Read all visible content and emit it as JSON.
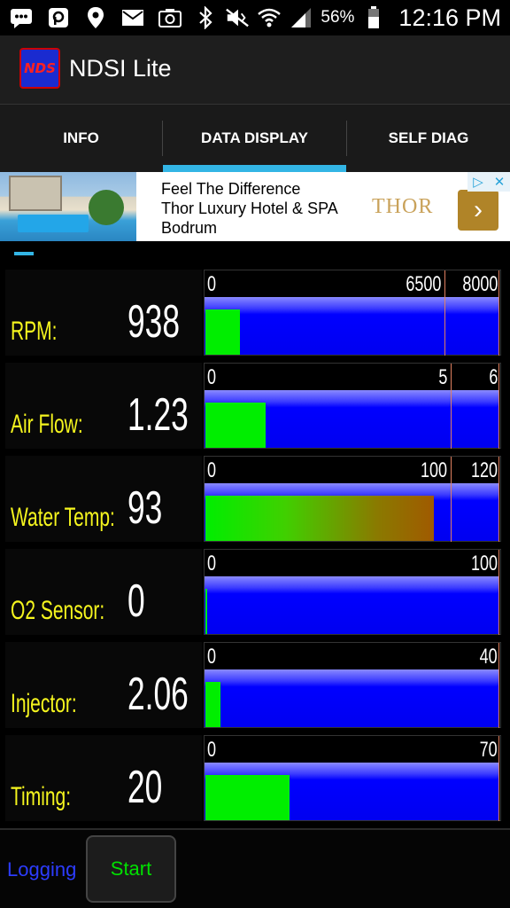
{
  "status_bar": {
    "battery_percent": "56%",
    "time": "12:16 PM",
    "icons": [
      "message-icon",
      "p-notification-icon",
      "location-icon",
      "email-icon",
      "camera-icon",
      "bluetooth-icon",
      "mute-icon",
      "wifi-icon",
      "signal-icon",
      "battery-icon"
    ]
  },
  "app": {
    "title": "NDSI Lite",
    "logo_text": "NDS"
  },
  "tabs": [
    {
      "label": "INFO"
    },
    {
      "label": "DATA DISPLAY",
      "selected": true
    },
    {
      "label": "SELF DIAG"
    }
  ],
  "ad": {
    "line1": "Feel The Difference",
    "line2": "Thor Luxury Hotel & SPA",
    "line3": "Bodrum",
    "brand": "THOR",
    "adchoices": "▷",
    "close": "✕",
    "go": "›"
  },
  "gauges": [
    {
      "label": "RPM:",
      "value": "938",
      "min": "0",
      "max_label": "8000",
      "mark_label": "6500",
      "max": 8000,
      "mark": 6500,
      "current": 938,
      "fill_style": "plain"
    },
    {
      "label": "Air Flow:",
      "value": "1.23",
      "min": "0",
      "max_label": "6",
      "mark_label": "5",
      "max": 6,
      "mark": 5,
      "current": 1.23,
      "fill_style": "plain"
    },
    {
      "label": "Water Temp:",
      "value": "93",
      "min": "0",
      "max_label": "120",
      "mark_label": "100",
      "max": 120,
      "mark": 100,
      "current": 93,
      "fill_style": "hot"
    },
    {
      "label": "O2 Sensor:",
      "value": "0",
      "min": "0",
      "max_label": "100",
      "mark_label": "",
      "max": 100,
      "mark": null,
      "current": 0,
      "fill_style": "plain"
    },
    {
      "label": "Injector:",
      "value": "2.06",
      "min": "0",
      "max_label": "40",
      "mark_label": "",
      "max": 40,
      "mark": null,
      "current": 2.06,
      "fill_style": "plain"
    },
    {
      "label": "Timing:",
      "value": "20",
      "min": "0",
      "max_label": "70",
      "mark_label": "",
      "max": 70,
      "mark": null,
      "current": 20,
      "fill_style": "plain"
    }
  ],
  "bottom": {
    "logging_label": "Logging",
    "start_label": "Start"
  },
  "colors": {
    "accent": "#33b5e5",
    "label_yellow": "#f5f51e",
    "gauge_blue": "#0000ff",
    "fill_green": "#00ee00",
    "logging_blue": "#2c3cff",
    "start_green": "#00e000"
  }
}
